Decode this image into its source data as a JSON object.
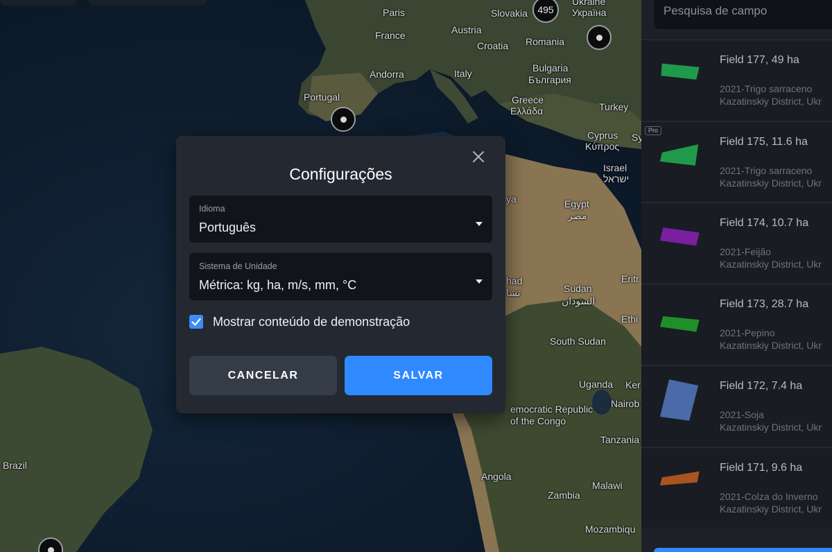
{
  "map": {
    "labels": {
      "paris": "Paris",
      "france": "France",
      "austria": "Austria",
      "slovakia": "Slovakia",
      "ukraine_en": "Ukraine",
      "ukraine_native": "Україна",
      "croatia": "Croatia",
      "romania": "Romania",
      "andorra": "Andorra",
      "italy": "Italy",
      "bulgaria_en": "Bulgaria",
      "bulgaria_native": "България",
      "portugal": "Portugal",
      "greece_en": "Greece",
      "greece_native": "Ελλάδα",
      "turkey": "Turkey",
      "cyprus_en": "Cyprus",
      "cyprus_native": "Κύπρος",
      "sy_fragment": "Sy",
      "israel_en": "Israel",
      "israel_native": "ישראל",
      "egypt_en": "Egypt",
      "egypt_native": "مصر",
      "ya_fragment": "ya",
      "had_fragment": "had",
      "had_native_fragment": "تشا",
      "sudan_en": "Sudan",
      "sudan_native": "السودان",
      "eritrea_fragment": "Eritr",
      "ethiopia_fragment": "Ethi",
      "south_sudan": "South Sudan",
      "uganda": "Uganda",
      "kenya_fragment": "Ker",
      "nairobi_fragment": "Nairob",
      "drc_line1": "emocratic Republic",
      "drc_line2": "of the Congo",
      "tanzania": "Tanzania",
      "brazil": "Brazil",
      "angola": "Angola",
      "malawi": "Malawi",
      "zambia": "Zambia",
      "mozambique_fragment": "Mozambiqu"
    },
    "cluster_count": "495"
  },
  "sidebar": {
    "search_placeholder": "Pesquisa de campo",
    "fields": [
      {
        "title": "Field 177, 49 ha",
        "crop": "2021-Trigo sarraceno",
        "district": "Kazatinskiy District, Ukr",
        "color": "#1f9a4a",
        "pro": false
      },
      {
        "title": "Field 175, 11.6 ha",
        "crop": "2021-Trigo sarraceno",
        "district": "Kazatinskiy District, Ukr",
        "color": "#1f9a4a",
        "pro": true,
        "pro_label": "Pro"
      },
      {
        "title": "Field 174, 10.7 ha",
        "crop": "2021-Feijão",
        "district": "Kazatinskiy District, Ukr",
        "color": "#7a1fa0",
        "pro": false
      },
      {
        "title": "Field 173, 28.7 ha",
        "crop": "2021-Pepino",
        "district": "Kazatinskiy District, Ukr",
        "color": "#1f8f2a",
        "pro": false
      },
      {
        "title": "Field 172, 7.4 ha",
        "crop": "2021-Soja",
        "district": "Kazatinskiy District, Ukr",
        "color": "#4a6aa8",
        "pro": false
      },
      {
        "title": "Field 171, 9.6 ha",
        "crop": "2021-Colza do Inverno",
        "district": "Kazatinskiy District, Ukr",
        "color": "#a85420",
        "pro": false
      }
    ]
  },
  "dialog": {
    "title": "Configurações",
    "language": {
      "label": "Idioma",
      "value": "Português"
    },
    "units": {
      "label": "Sistema de Unidade",
      "value": "Métrica: kg, ha, m/s, mm, °C"
    },
    "demo": {
      "label": "Mostrar conteúdo de demonstração",
      "checked": true
    },
    "cancel_label": "CANCELAR",
    "save_label": "SALVAR"
  }
}
